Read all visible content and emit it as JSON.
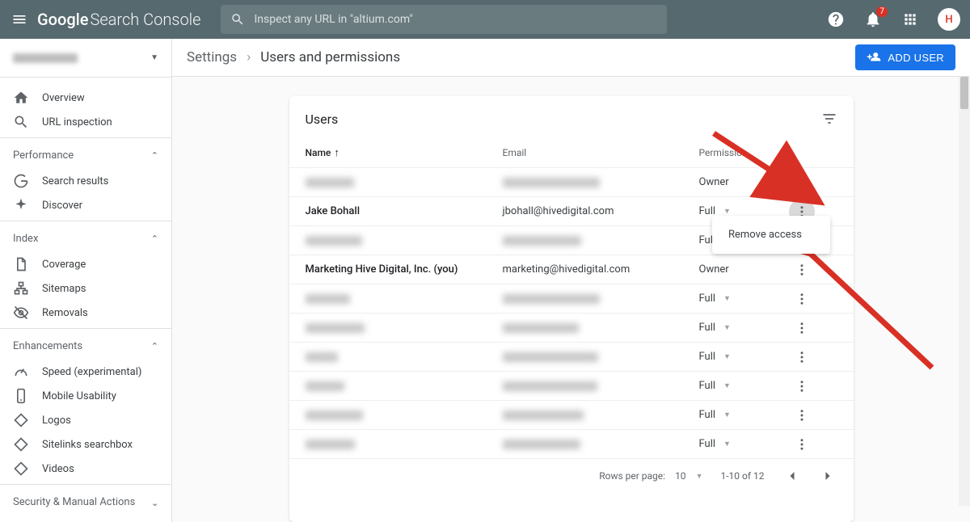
{
  "header": {
    "logo_google": "Google",
    "logo_sc": "Search Console",
    "search_placeholder": "Inspect any URL in \"altium.com\"",
    "notification_count": "7",
    "avatar_letter": "H"
  },
  "sidebar": {
    "nav_overview": "Overview",
    "nav_urlinspection": "URL inspection",
    "section_performance": "Performance",
    "nav_searchresults": "Search results",
    "nav_discover": "Discover",
    "section_index": "Index",
    "nav_coverage": "Coverage",
    "nav_sitemaps": "Sitemaps",
    "nav_removals": "Removals",
    "section_enhancements": "Enhancements",
    "nav_speed": "Speed (experimental)",
    "nav_mobile": "Mobile Usability",
    "nav_logos": "Logos",
    "nav_sitelinks": "Sitelinks searchbox",
    "nav_videos": "Videos",
    "section_security": "Security & Manual Actions"
  },
  "subheader": {
    "bc_settings": "Settings",
    "bc_current": "Users and permissions",
    "add_user": "ADD USER"
  },
  "card": {
    "title": "Users",
    "col_name": "Name",
    "col_email": "Email",
    "col_permission": "Permission",
    "rows": [
      {
        "name_blurred": true,
        "email_blurred": true,
        "permission": "Owner",
        "has_dropdown": false
      },
      {
        "name": "Jake Bohall",
        "email": "jbohall@hivedigital.com",
        "permission": "Full",
        "has_dropdown": true,
        "menu_highlighted": true
      },
      {
        "name_blurred": true,
        "email_blurred": true,
        "permission": "Full",
        "has_dropdown": true
      },
      {
        "name": "Marketing Hive Digital, Inc. (you)",
        "email": "marketing@hivedigital.com",
        "permission": "Owner",
        "has_dropdown": false,
        "bold": true
      },
      {
        "name_blurred": true,
        "email_blurred": true,
        "permission": "Full",
        "has_dropdown": true
      },
      {
        "name_blurred": true,
        "email_blurred": true,
        "permission": "Full",
        "has_dropdown": true
      },
      {
        "name_blurred": true,
        "email_blurred": true,
        "permission": "Full",
        "has_dropdown": true
      },
      {
        "name_blurred": true,
        "email_blurred": true,
        "permission": "Full",
        "has_dropdown": true
      },
      {
        "name_blurred": true,
        "email_blurred": true,
        "permission": "Full",
        "has_dropdown": true
      },
      {
        "name_blurred": true,
        "email_blurred": true,
        "permission": "Full",
        "has_dropdown": true
      }
    ],
    "menu_remove_access": "Remove access",
    "footer_rpp_label": "Rows per page:",
    "footer_rpp_value": "10",
    "footer_range": "1-10 of 12"
  }
}
